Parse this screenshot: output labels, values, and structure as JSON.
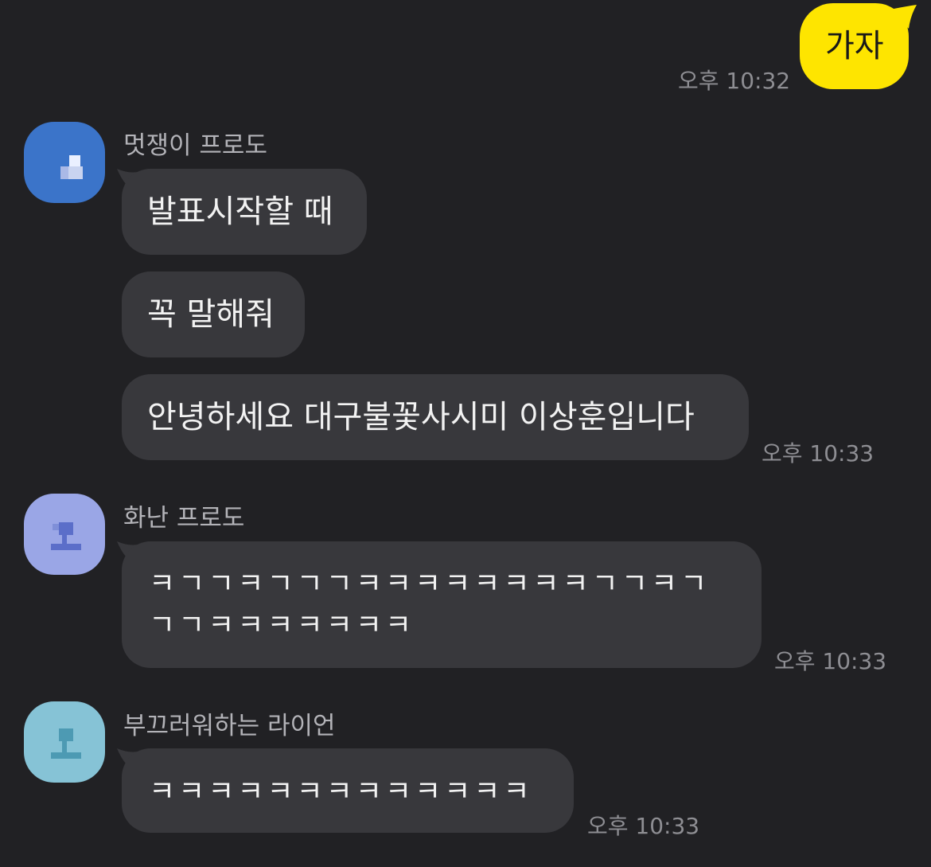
{
  "colors": {
    "background": "#212124",
    "bubble_other": "#38383c",
    "bubble_mine": "#fee500",
    "avatar_1": "#3b74c9",
    "avatar_2": "#9aa6e6",
    "avatar_3": "#86c3d6"
  },
  "messages": [
    {
      "sender": "me",
      "text": "가자",
      "time": "오후 10:32"
    },
    {
      "sender": "멋쟁이 프로도",
      "texts": [
        "발표시작할 때",
        "꼭 말해줘",
        "안녕하세요 대구불꽃사시미 이상훈입니다"
      ],
      "time": "오후 10:33"
    },
    {
      "sender": "화난 프로도",
      "lines": [
        "ㅋㄱㄱㅋㄱㄱㄱㅋㅋㅋㅋㅋㅋㅋㅋㄱㄱㅋㄱ",
        "ㄱㄱㅋㅋㅋㅋㅋㅋㅋ"
      ],
      "time": "오후 10:33"
    },
    {
      "sender": "부끄러워하는 라이언",
      "text": "ㅋㅋㅋㅋㅋㅋㅋㅋㅋㅋㅋㅋㅋ",
      "time": "오후 10:33"
    }
  ]
}
